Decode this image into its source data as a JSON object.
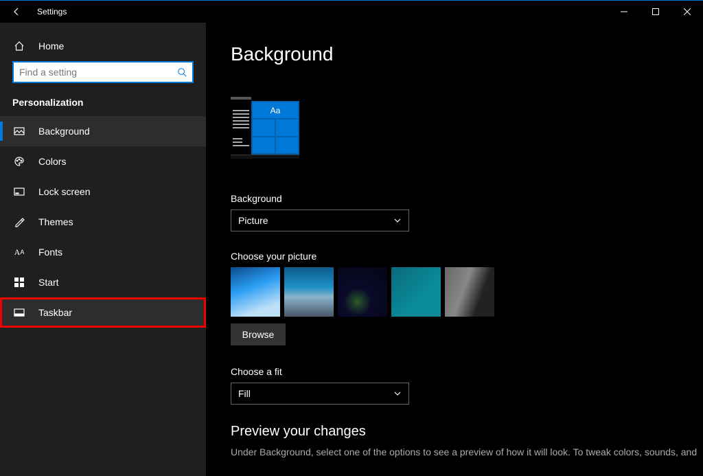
{
  "titlebar": {
    "title": "Settings"
  },
  "sidebar": {
    "home": "Home",
    "search_placeholder": "Find a setting",
    "category": "Personalization",
    "items": [
      {
        "label": "Background"
      },
      {
        "label": "Colors"
      },
      {
        "label": "Lock screen"
      },
      {
        "label": "Themes"
      },
      {
        "label": "Fonts"
      },
      {
        "label": "Start"
      },
      {
        "label": "Taskbar"
      }
    ]
  },
  "main": {
    "title": "Background",
    "preview_label": "Aa",
    "bg_label": "Background",
    "bg_value": "Picture",
    "choose_label": "Choose your picture",
    "browse": "Browse",
    "fit_label": "Choose a fit",
    "fit_value": "Fill",
    "preview_section": "Preview your changes",
    "preview_help": "Under Background, select one of the options to see a preview of how it will look. To tweak colors, sounds, and"
  }
}
